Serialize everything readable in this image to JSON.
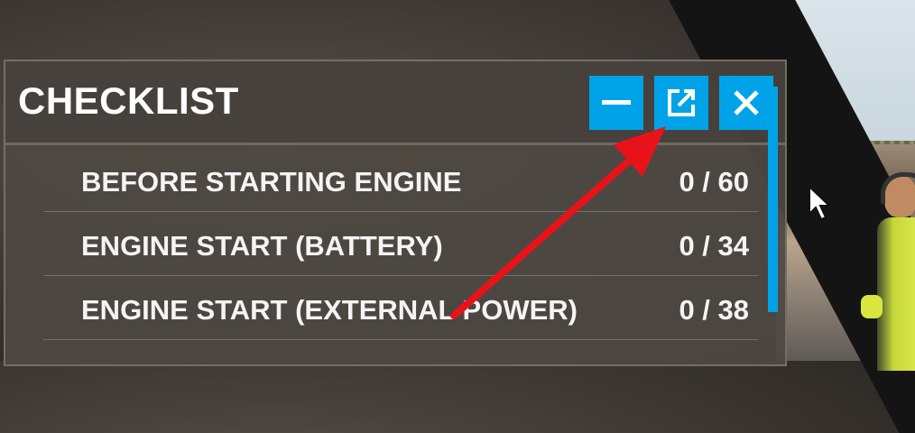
{
  "panel": {
    "title": "CHECKLIST",
    "buttons": [
      {
        "name": "minimize",
        "icon": "minus-icon"
      },
      {
        "name": "popout",
        "icon": "popout-window-icon"
      },
      {
        "name": "close",
        "icon": "close-icon"
      }
    ]
  },
  "checklist": {
    "items": [
      {
        "label": "BEFORE STARTING ENGINE",
        "count": "0 / 60"
      },
      {
        "label": "ENGINE START (BATTERY)",
        "count": "0 / 34"
      },
      {
        "label": "ENGINE START (EXTERNAL POWER)",
        "count": "0 / 38"
      }
    ]
  },
  "colors": {
    "accent": "#00a3e8",
    "annotation_arrow": "#e8131a",
    "panel_bg": "#4e4842",
    "text": "#ffffff"
  }
}
